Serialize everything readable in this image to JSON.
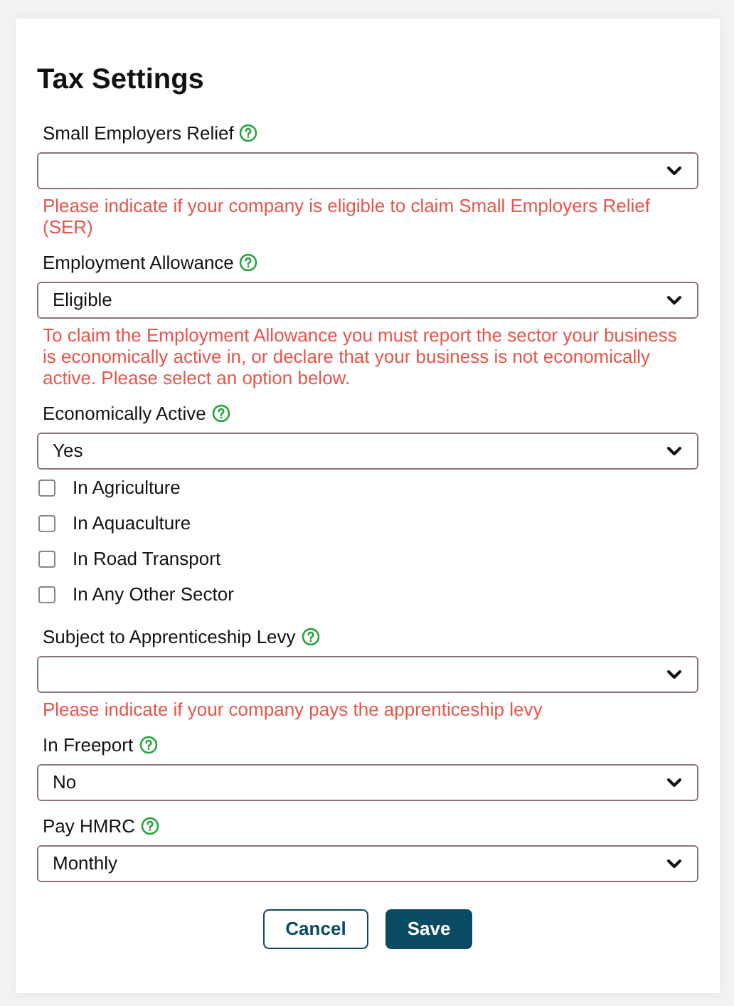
{
  "title": "Tax Settings",
  "fields": [
    {
      "kind": "select",
      "label": "Small Employers Relief",
      "message": "Please indicate if your company is eligible to claim Small Employers Relief (SER)"
    },
    {
      "kind": "select",
      "label": "Employment Allowance",
      "value": "Eligible",
      "message": "To claim the Employment Allowance you must report the sector your business is economically active in, or declare that your business is not economically active.  Please select an option below."
    },
    {
      "kind": "select",
      "label": "Economically Active",
      "value": "Yes"
    },
    {
      "kind": "checkbox",
      "label": "In Agriculture",
      "checked": false
    },
    {
      "kind": "checkbox",
      "label": "In Aquaculture",
      "checked": false
    },
    {
      "kind": "checkbox",
      "label": "In Road Transport",
      "checked": false
    },
    {
      "kind": "checkbox",
      "label": "In Any Other Sector",
      "checked": false
    },
    {
      "kind": "select",
      "label": "Subject to Apprenticeship Levy",
      "message": "Please indicate if your company pays the apprenticeship levy"
    },
    {
      "kind": "select",
      "label": "In Freeport",
      "value": "No"
    },
    {
      "kind": "select",
      "label": "Pay HMRC",
      "value": "Monthly"
    }
  ],
  "buttons": [
    {
      "kind": "secondary",
      "label": "Cancel"
    },
    {
      "kind": "primary",
      "label": "Save"
    }
  ]
}
